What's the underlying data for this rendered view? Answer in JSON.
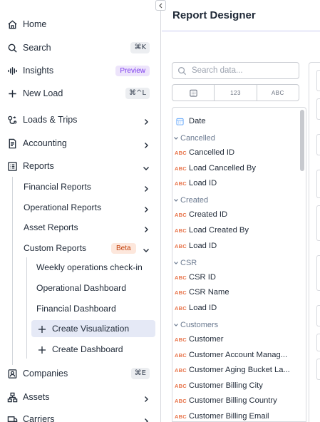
{
  "sidebar": {
    "nav": [
      {
        "label": "Home",
        "icon": "home-icon"
      },
      {
        "label": "Search",
        "icon": "search-icon",
        "shortcut": "⌘K"
      },
      {
        "label": "Insights",
        "icon": "insights-icon",
        "badge": "Preview"
      },
      {
        "label": "New Load",
        "icon": "plus-icon",
        "shortcut": "⌘^L"
      },
      {
        "label": "Loads & Trips",
        "icon": "route-icon"
      },
      {
        "label": "Accounting",
        "icon": "accounting-icon"
      },
      {
        "label": "Reports",
        "icon": "reports-icon"
      }
    ],
    "reports_sub": [
      {
        "label": "Financial Reports"
      },
      {
        "label": "Operational Reports"
      },
      {
        "label": "Asset Reports"
      },
      {
        "label": "Custom Reports",
        "badge": "Beta"
      }
    ],
    "custom_sub": [
      {
        "label": "Weekly operations check-in"
      },
      {
        "label": "Operational Dashboard"
      },
      {
        "label": "Financial Dashboard"
      },
      {
        "label": "Create Visualization"
      },
      {
        "label": "Create Dashboard"
      }
    ],
    "bottom": [
      {
        "label": "Companies",
        "icon": "companies-icon",
        "shortcut": "⌘E"
      },
      {
        "label": "Assets",
        "icon": "assets-icon"
      },
      {
        "label": "Carriers",
        "icon": "carriers-icon"
      }
    ]
  },
  "main": {
    "title": "Report Designer",
    "search_placeholder": "Search data...",
    "type_tabs": [
      "calendar-icon",
      "123",
      "ABC"
    ],
    "fields": {
      "date_field": "Date",
      "groups": [
        {
          "name": "Cancelled",
          "items": [
            "Cancelled ID",
            "Load Cancelled By",
            "Load ID"
          ]
        },
        {
          "name": "Created",
          "items": [
            "Created ID",
            "Load Created By",
            "Load ID"
          ]
        },
        {
          "name": "CSR",
          "items": [
            "CSR ID",
            "CSR Name",
            "Load ID"
          ]
        },
        {
          "name": "Customers",
          "items": [
            "Customer",
            "Customer Account Manag...",
            "Customer Aging Bucket La...",
            "Customer Billing City",
            "Customer Billing Country",
            "Customer Billing Email"
          ]
        }
      ],
      "type_label": "ABC"
    }
  }
}
